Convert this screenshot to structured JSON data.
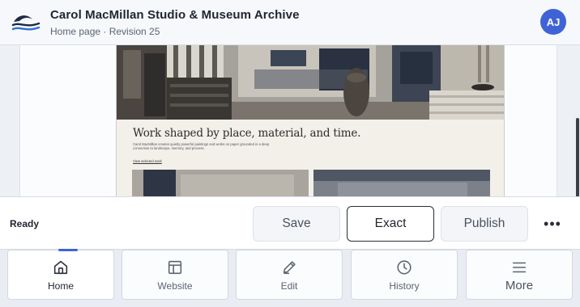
{
  "header": {
    "title": "Carol MacMillan Studio & Museum Archive",
    "subtitle": "Home page · Revision 25",
    "logo_icon": "wave-logo-icon",
    "avatar_initials": "AJ"
  },
  "preview": {
    "headline": "Work shaped by place, material, and time.",
    "body": "Carol MacMillan creates quietly powerful paintings and works on paper grounded in a deep connection to landscape, memory, and process.",
    "link": "View selected work"
  },
  "actions": {
    "status": "Ready",
    "save_label": "Save",
    "exact_label": "Exact",
    "publish_label": "Publish",
    "more_icon": "more-horizontal-icon",
    "more_label": "•••"
  },
  "nav": {
    "active": "Home",
    "items": [
      {
        "label": "Home",
        "icon": "home-icon"
      },
      {
        "label": "Website",
        "icon": "layout-icon"
      },
      {
        "label": "Edit",
        "icon": "pencil-icon"
      },
      {
        "label": "History",
        "icon": "clock-icon"
      },
      {
        "label": "More",
        "icon": "menu-icon"
      }
    ]
  },
  "colors": {
    "accent": "#3f63d6",
    "header_bg": "#f6f8fb",
    "page_bg": "#f3f0ea"
  }
}
